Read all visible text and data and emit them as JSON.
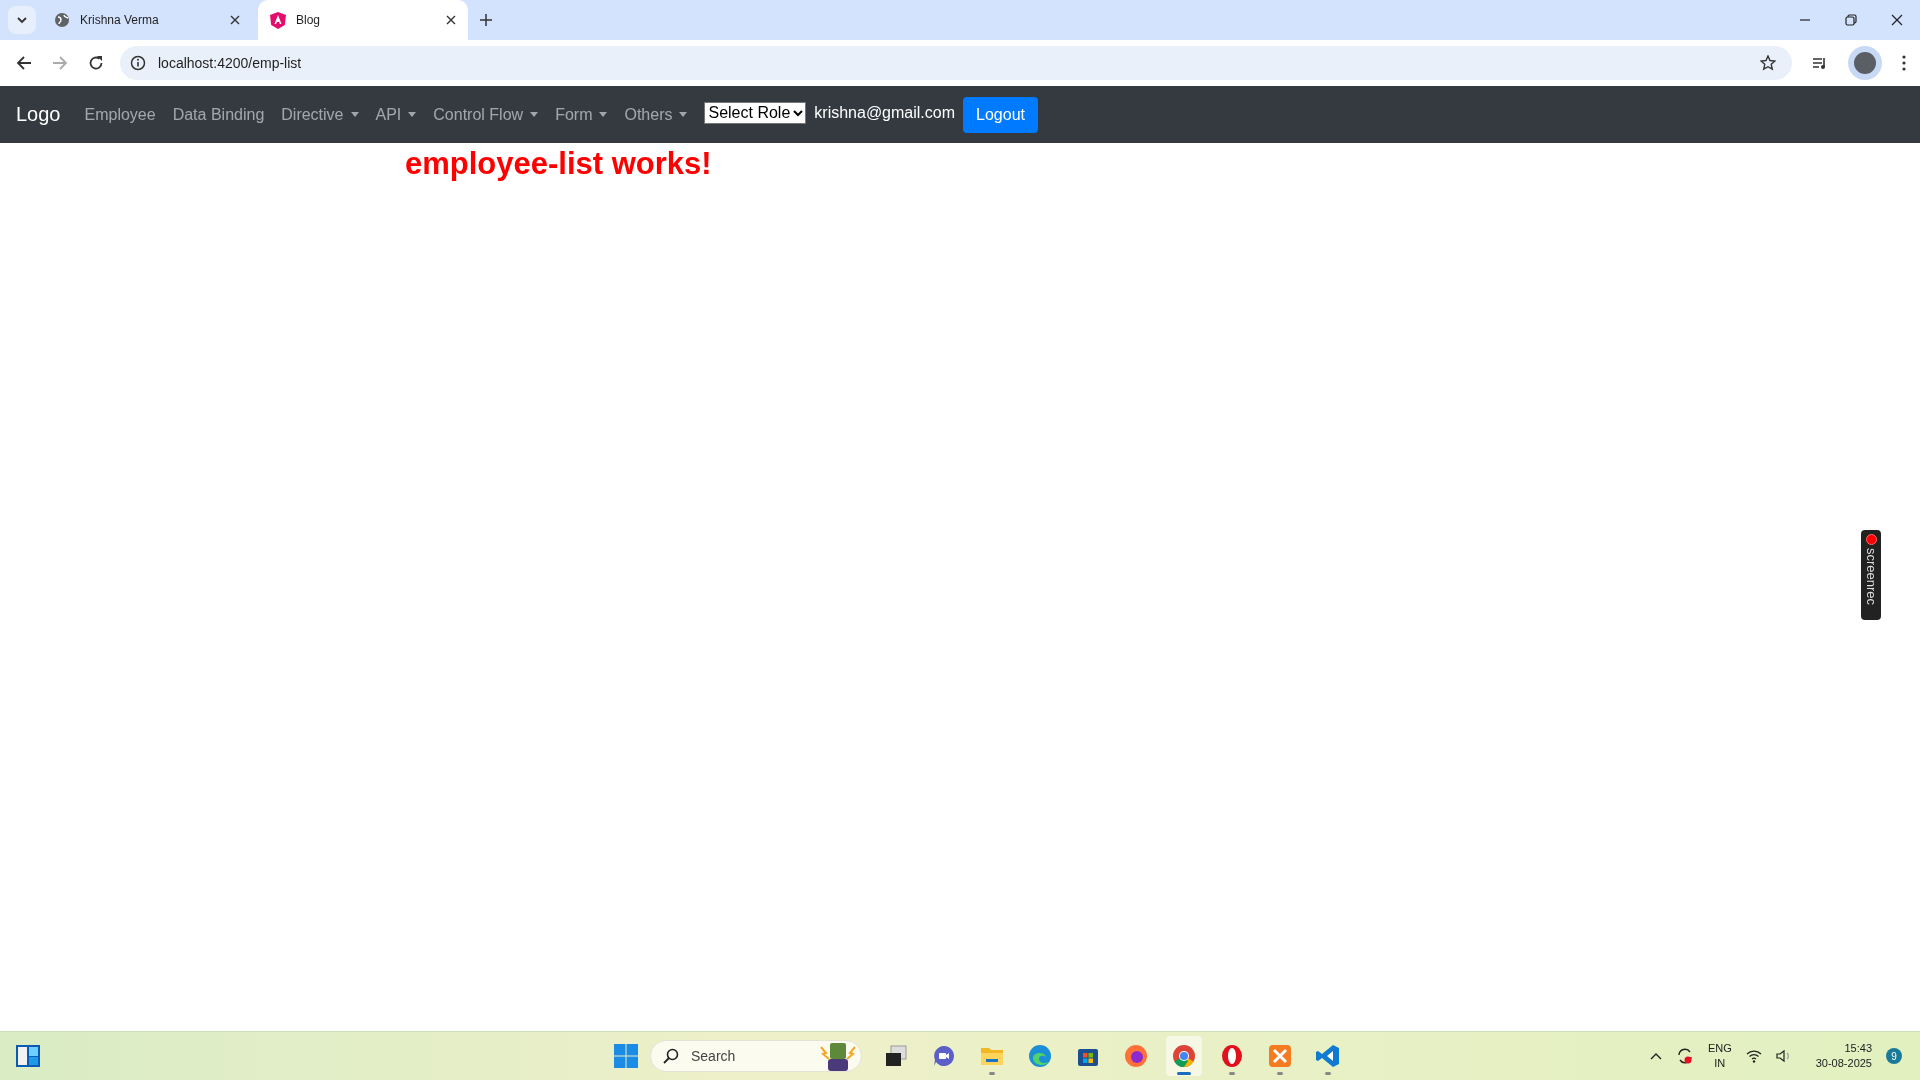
{
  "browser": {
    "tabs": [
      {
        "title": "Krishna Verma",
        "kind": "globe",
        "selected": false
      },
      {
        "title": "Blog",
        "kind": "shield",
        "selected": true
      }
    ],
    "address": "localhost:4200/emp-list"
  },
  "navbar": {
    "brand": "Logo",
    "items": [
      {
        "label": "Employee",
        "dropdown": false
      },
      {
        "label": "Data Binding",
        "dropdown": false
      },
      {
        "label": "Directive",
        "dropdown": true
      },
      {
        "label": "API",
        "dropdown": true
      },
      {
        "label": "Control Flow",
        "dropdown": true
      },
      {
        "label": "Form",
        "dropdown": true
      },
      {
        "label": "Others",
        "dropdown": true
      }
    ],
    "role_select": {
      "value": "Select Role"
    },
    "user_email": "krishna@gmail.com",
    "logout": "Logout"
  },
  "heading": "employee-list works!",
  "recorder_tab": "screenrec",
  "taskbar": {
    "search": {
      "placeholder": "Search"
    },
    "apps": [
      {
        "kind": "taskview",
        "running": false,
        "selected": false
      },
      {
        "kind": "meet",
        "running": false,
        "selected": false
      },
      {
        "kind": "folder",
        "running": true,
        "selected": false
      },
      {
        "kind": "edge",
        "running": false,
        "selected": false
      },
      {
        "kind": "store",
        "running": false,
        "selected": false
      },
      {
        "kind": "firefox",
        "running": false,
        "selected": false
      },
      {
        "kind": "chrome",
        "running": true,
        "selected": true
      },
      {
        "kind": "opera",
        "running": true,
        "selected": false
      },
      {
        "kind": "xampp",
        "running": true,
        "selected": false
      },
      {
        "kind": "vscode",
        "running": true,
        "selected": false
      }
    ],
    "tray": {
      "language": "ENG",
      "region": "IN",
      "time": "15:43",
      "date": "30-08-2025",
      "notifications": "9"
    }
  }
}
